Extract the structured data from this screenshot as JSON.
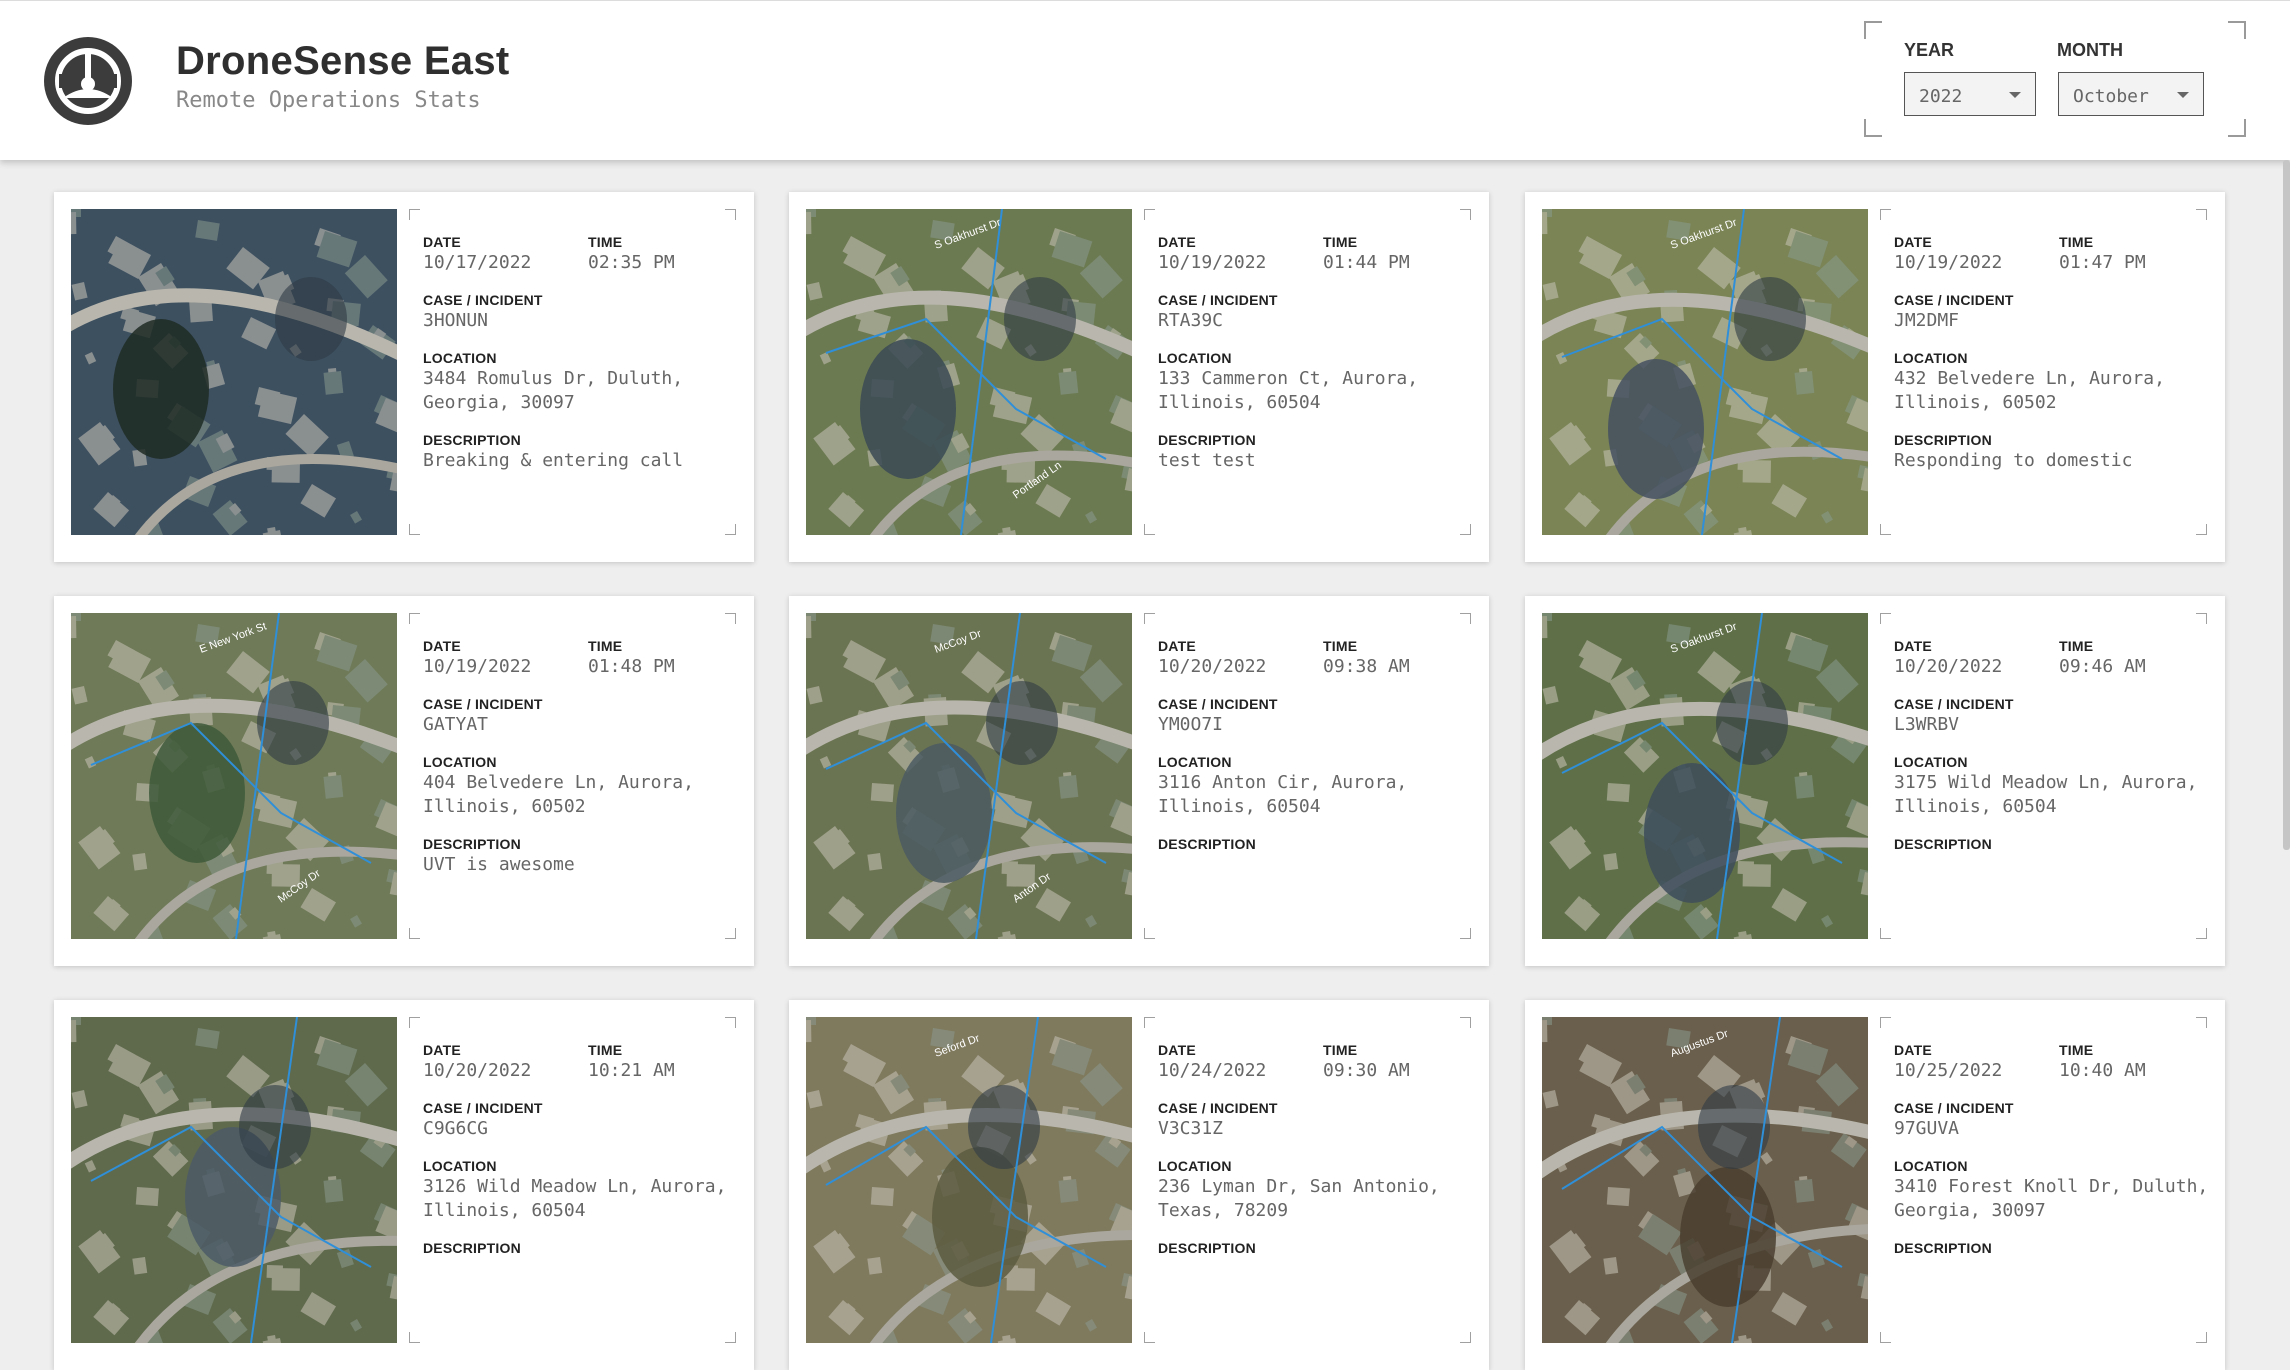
{
  "header": {
    "title": "DroneSense East",
    "subtitle": "Remote Operations Stats"
  },
  "filters": {
    "year_label": "YEAR",
    "year_value": "2022",
    "month_label": "MONTH",
    "month_value": "October"
  },
  "labels": {
    "date": "DATE",
    "time": "TIME",
    "case": "CASE / INCIDENT",
    "location": "LOCATION",
    "description": "DESCRIPTION"
  },
  "cards": [
    {
      "date": "10/17/2022",
      "time": "02:35 PM",
      "case": "3HONUN",
      "location": "3484 Romulus Dr, Duluth, Georgia, 30097",
      "description": "Breaking & entering call"
    },
    {
      "date": "10/19/2022",
      "time": "01:44 PM",
      "case": "RTA39C",
      "location": "133 Cammeron Ct, Aurora, Illinois, 60504",
      "description": "test test"
    },
    {
      "date": "10/19/2022",
      "time": "01:47 PM",
      "case": "JM2DMF",
      "location": "432 Belvedere Ln, Aurora, Illinois, 60502",
      "description": "Responding to domestic"
    },
    {
      "date": "10/19/2022",
      "time": "01:48 PM",
      "case": "GATYAT",
      "location": "404 Belvedere Ln, Aurora, Illinois, 60502",
      "description": "UVT is awesome"
    },
    {
      "date": "10/20/2022",
      "time": "09:38 AM",
      "case": "YM0O7I",
      "location": "3116 Anton Cir, Aurora, Illinois, 60504",
      "description": ""
    },
    {
      "date": "10/20/2022",
      "time": "09:46 AM",
      "case": "L3WRBV",
      "location": "3175 Wild Meadow Ln, Aurora, Illinois, 60504",
      "description": ""
    },
    {
      "date": "10/20/2022",
      "time": "10:21 AM",
      "case": "C9G6CG",
      "location": "3126 Wild Meadow Ln, Aurora, Illinois, 60504",
      "description": ""
    },
    {
      "date": "10/24/2022",
      "time": "09:30 AM",
      "case": "V3C31Z",
      "location": "236 Lyman Dr, San Antonio, Texas, 78209",
      "description": ""
    },
    {
      "date": "10/25/2022",
      "time": "10:40 AM",
      "case": "97GUVA",
      "location": "3410 Forest Knoll Dr, Duluth, Georgia, 30097",
      "description": ""
    }
  ],
  "map_labels": [
    [
      "",
      ""
    ],
    [
      "S Oakhurst Dr",
      "Portland Ln"
    ],
    [
      "S Oakhurst Dr",
      ""
    ],
    [
      "E New York St",
      "McCoy Dr"
    ],
    [
      "McCoy Dr",
      "Anton Dr"
    ],
    [
      "S Oakhurst Dr",
      ""
    ],
    [
      "",
      ""
    ],
    [
      "Seford Dr",
      ""
    ],
    [
      "Augustus Dr",
      ""
    ]
  ],
  "colors": {
    "flight_path": "#2f8fd8",
    "background": "#eeeeee"
  }
}
